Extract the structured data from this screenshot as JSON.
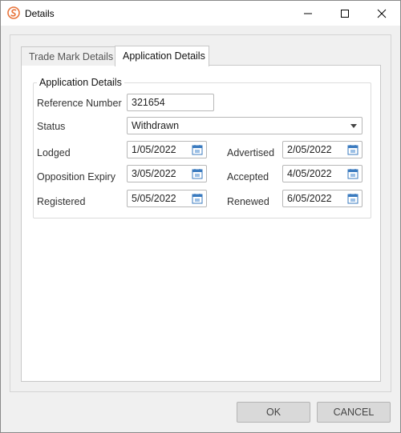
{
  "window": {
    "title": "Details"
  },
  "tabs": [
    {
      "label": "Trade Mark Details"
    },
    {
      "label": "Application Details"
    }
  ],
  "group": {
    "legend": "Application Details",
    "reference": {
      "label": "Reference Number",
      "value": "321654"
    },
    "status": {
      "label": "Status",
      "value": "Withdrawn"
    },
    "dates": {
      "lodged": {
        "label": "Lodged",
        "value": "1/05/2022"
      },
      "advertised": {
        "label": "Advertised",
        "value": "2/05/2022"
      },
      "opposition_expiry": {
        "label": "Opposition Expiry",
        "value": "3/05/2022"
      },
      "accepted": {
        "label": "Accepted",
        "value": "4/05/2022"
      },
      "registered": {
        "label": "Registered",
        "value": "5/05/2022"
      },
      "renewed": {
        "label": "Renewed",
        "value": "6/05/2022"
      }
    }
  },
  "buttons": {
    "ok": "OK",
    "cancel": "CANCEL"
  },
  "colors": {
    "app_icon": "#e8743b",
    "calendar_icon": "#3b7bbf"
  }
}
